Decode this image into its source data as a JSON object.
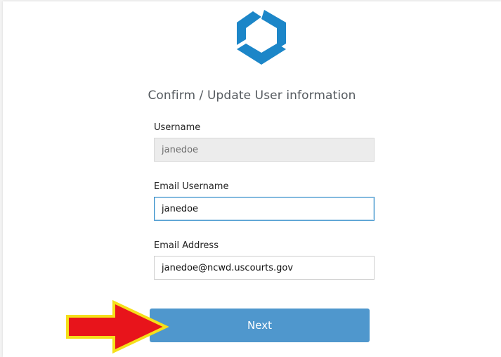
{
  "form": {
    "title": "Confirm / Update User information",
    "username": {
      "label": "Username",
      "value": "janedoe"
    },
    "email_username": {
      "label": "Email Username",
      "value": "janedoe"
    },
    "email_address": {
      "label": "Email Address",
      "value": "janedoe@ncwd.uscourts.gov"
    },
    "next_label": "Next"
  },
  "colors": {
    "logo_blue": "#1c86c8",
    "button_blue": "#4f97cd",
    "arrow_red": "#e8141b",
    "arrow_outline": "#f5df1a"
  },
  "icons": {
    "logo": "hexagon-logo-icon",
    "arrow": "red-arrow-annotation"
  }
}
